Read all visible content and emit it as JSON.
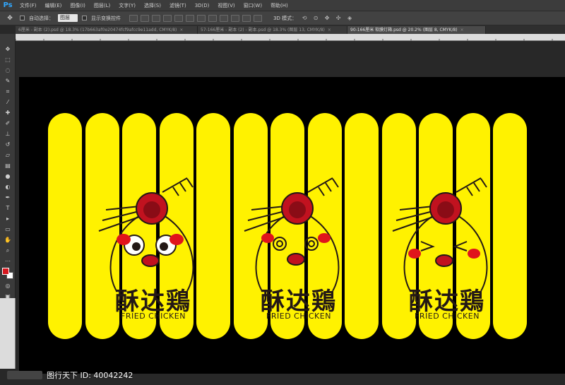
{
  "app": {
    "logo": "Ps",
    "menu": [
      "文件(F)",
      "编辑(E)",
      "图像(I)",
      "图层(L)",
      "文字(Y)",
      "选择(S)",
      "滤镜(T)",
      "3D(D)",
      "视图(V)",
      "窗口(W)",
      "帮助(H)"
    ]
  },
  "options": {
    "move_icon": "move-tool-icon",
    "auto_select_label": "自动选择：",
    "auto_select_value": "图层",
    "show_transform_label": "显示变换控件",
    "mode3d_label": "3D 模式："
  },
  "tabs": [
    {
      "label": "6厘米 - 副本 (2).psd @ 18.3% (17b663af0e20474fcf9afcc9e11add, CMYK/8)",
      "active": false
    },
    {
      "label": "57-166厘米 - 副本 (2) - 副本.psd @ 18.3% (图层 13, CMYK/8)",
      "active": false
    },
    {
      "label": "90-166厘米 软膜灯箱.psd @ 20.2% (图层 8, CMYK/8)",
      "active": true
    }
  ],
  "tools": [
    "move",
    "marquee",
    "lasso",
    "quick-select",
    "crop",
    "eyedropper",
    "healing",
    "brush",
    "stamp",
    "history-brush",
    "eraser",
    "gradient",
    "blur",
    "dodge",
    "pen",
    "type",
    "path-select",
    "shape",
    "hand",
    "zoom"
  ],
  "colors": {
    "foreground": "#d71920",
    "background": "#ffffff",
    "stick_yellow": "#fff200",
    "canvas_bg": "#000000"
  },
  "canvas": {
    "stick_count": 13,
    "brands": [
      {
        "name": "酥达鶏",
        "sub": "FRIED CHICKEN"
      },
      {
        "name": "酥达鶏",
        "sub": "FRIED CHICKEN"
      },
      {
        "name": "酥达鶏",
        "sub": "FRIED CHICKEN"
      }
    ]
  },
  "watermark": {
    "text": "图行天下 ID: 40042242"
  }
}
